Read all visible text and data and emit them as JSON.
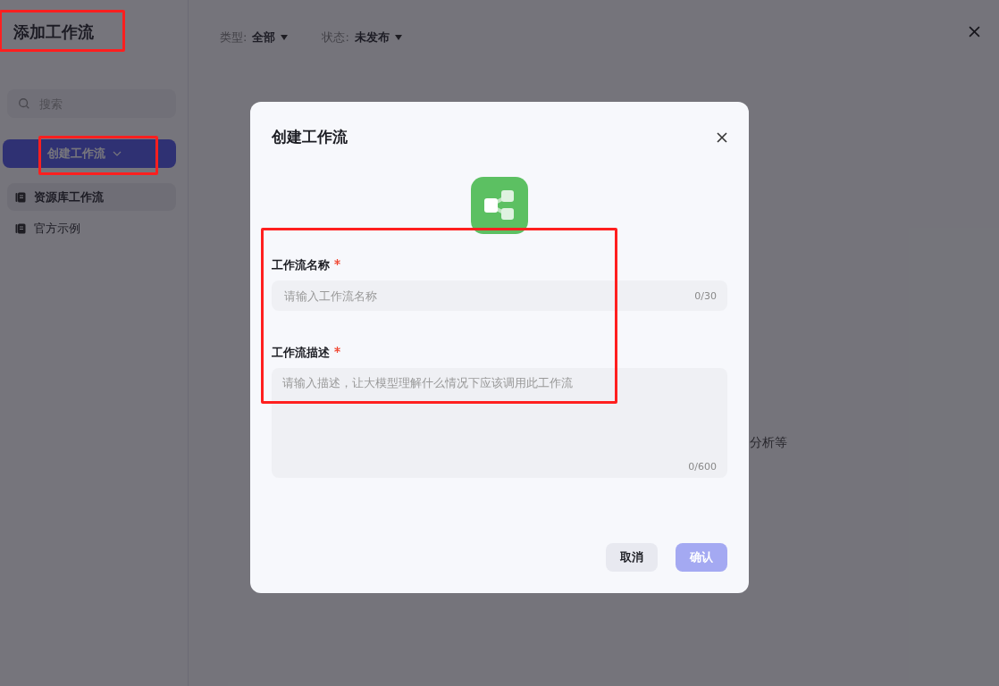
{
  "sidebar": {
    "title": "添加工作流",
    "title_highlighted": true,
    "search": {
      "placeholder": "搜索"
    },
    "create_button": {
      "label": "创建工作流",
      "highlighted": true
    },
    "items": [
      {
        "label": "资源库工作流",
        "selected": true
      },
      {
        "label": "官方示例",
        "selected": false
      }
    ]
  },
  "filters": [
    {
      "label": "类型:",
      "value": "全部"
    },
    {
      "label": "状态:",
      "value": "未发布"
    }
  ],
  "background_text": "分析等",
  "dialog": {
    "title": "创建工作流",
    "form_highlighted": true,
    "fields": [
      {
        "kind": "input",
        "label": "工作流名称",
        "required": true,
        "placeholder": "请输入工作流名称",
        "counter": "0/30"
      },
      {
        "kind": "textarea",
        "label": "工作流描述",
        "required": true,
        "placeholder": "请输入描述，让大模型理解什么情况下应该调用此工作流",
        "counter": "0/600"
      }
    ],
    "buttons": [
      {
        "label": "取消",
        "kind": "secondary",
        "disabled": false
      },
      {
        "label": "确认",
        "kind": "primary",
        "disabled": true
      }
    ]
  }
}
